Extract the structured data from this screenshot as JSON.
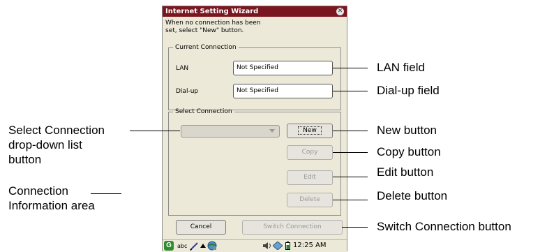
{
  "dialog": {
    "title": "Internet Setting Wizard",
    "close_glyph": "✕",
    "intro_line1": "When no connection has been",
    "intro_line2": "set, select \"New\" button.",
    "current_connection": {
      "legend": "Current Connection",
      "lan_label": "LAN",
      "lan_value": "Not Specified",
      "dialup_label": "Dial-up",
      "dialup_value": "Not Specified"
    },
    "select_connection": {
      "legend": "Select Connection",
      "dropdown_value": "",
      "new_label": "New",
      "copy_label": "Copy",
      "edit_label": "Edit",
      "delete_label": "Delete"
    },
    "cancel_label": "Cancel",
    "switch_label": "Switch Connection"
  },
  "taskbar": {
    "start_glyph": "G",
    "ime_text": "abc",
    "clock": "12:25 AM"
  },
  "callouts": {
    "lan_field": "LAN field",
    "dialup_field": "Dial-up field",
    "new_button": "New button",
    "copy_button": "Copy button",
    "edit_button": "Edit button",
    "delete_button": "Delete button",
    "switch_button": "Switch Connection button",
    "select_line1": "Select Connection",
    "select_line2": "drop-down list",
    "select_line3": "button",
    "info_line1": "Connection",
    "info_line2": "Information area"
  },
  "colors": {
    "titlebar": "#7a1620",
    "window_bg": "#ece9d8",
    "disabled_text": "#9a9a9a"
  }
}
